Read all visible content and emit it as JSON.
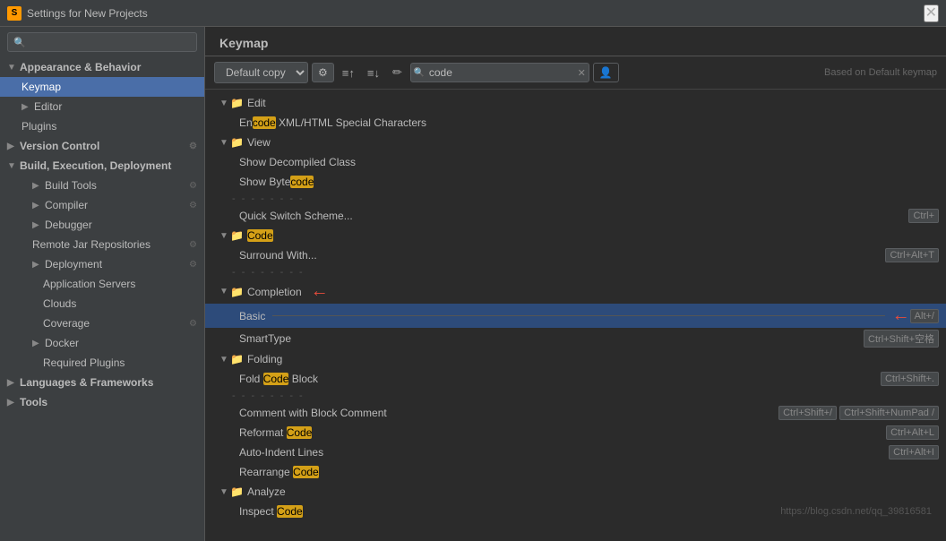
{
  "titlebar": {
    "icon": "S",
    "title": "Settings for New Projects",
    "close": "✕"
  },
  "sidebar": {
    "search_placeholder": "🔍",
    "items": [
      {
        "id": "appearance",
        "label": "Appearance & Behavior",
        "level": "category",
        "expand": "▼",
        "has_icon": false
      },
      {
        "id": "keymap",
        "label": "Keymap",
        "level": "sub1",
        "selected": true
      },
      {
        "id": "editor",
        "label": "Editor",
        "level": "category-sub",
        "expand": "▶"
      },
      {
        "id": "plugins",
        "label": "Plugins",
        "level": "sub1"
      },
      {
        "id": "version-control",
        "label": "Version Control",
        "level": "category",
        "expand": "▶",
        "settings": true
      },
      {
        "id": "build-exec",
        "label": "Build, Execution, Deployment",
        "level": "category",
        "expand": "▼"
      },
      {
        "id": "build-tools",
        "label": "Build Tools",
        "level": "sub1",
        "expand": "▶",
        "settings": true
      },
      {
        "id": "compiler",
        "label": "Compiler",
        "level": "sub1",
        "expand": "▶",
        "settings": true
      },
      {
        "id": "debugger",
        "label": "Debugger",
        "level": "sub1",
        "expand": "▶"
      },
      {
        "id": "remote-jar",
        "label": "Remote Jar Repositories",
        "level": "sub1",
        "settings": true
      },
      {
        "id": "deployment",
        "label": "Deployment",
        "level": "sub1",
        "expand": "▶",
        "settings": true
      },
      {
        "id": "app-servers",
        "label": "Application Servers",
        "level": "sub2"
      },
      {
        "id": "clouds",
        "label": "Clouds",
        "level": "sub2"
      },
      {
        "id": "coverage",
        "label": "Coverage",
        "level": "sub2",
        "settings": true
      },
      {
        "id": "docker",
        "label": "Docker",
        "level": "sub1",
        "expand": "▶"
      },
      {
        "id": "required-plugins",
        "label": "Required Plugins",
        "level": "sub2"
      },
      {
        "id": "languages",
        "label": "Languages & Frameworks",
        "level": "category",
        "expand": "▶"
      },
      {
        "id": "tools",
        "label": "Tools",
        "level": "category",
        "expand": "▶"
      }
    ]
  },
  "content": {
    "title": "Keymap",
    "keymap_select": "Default copy",
    "based_text": "Based on Default keymap",
    "search_value": "code",
    "toolbar_icons": [
      "≡↑",
      "≡↓",
      "✏"
    ],
    "tree": [
      {
        "type": "section",
        "label": "Edit",
        "expand": "▼",
        "indent": 0
      },
      {
        "type": "item",
        "pre": "En",
        "highlight": "code",
        "post": " XML/HTML Special Characters",
        "indent": 1
      },
      {
        "type": "section",
        "label": "View",
        "expand": "▼",
        "indent": 0
      },
      {
        "type": "item",
        "label": "Show Decompiled Class",
        "indent": 1
      },
      {
        "type": "item",
        "pre": "Show Byte",
        "highlight": "code",
        "post": "",
        "indent": 1
      },
      {
        "type": "divider",
        "indent": 1
      },
      {
        "type": "item",
        "label": "Quick Switch Scheme...",
        "indent": 1,
        "shortcut": "Ctrl+"
      },
      {
        "type": "section",
        "label": "Code",
        "expand": "▼",
        "indent": 0,
        "folder_highlight": true
      },
      {
        "type": "item",
        "label": "Surround With...",
        "indent": 1,
        "shortcut": "Ctrl+Alt+T"
      },
      {
        "type": "divider",
        "indent": 1
      },
      {
        "type": "section",
        "label": "Completion",
        "expand": "▼",
        "indent": 0
      },
      {
        "type": "item",
        "label": "Basic",
        "indent": 1,
        "shortcut": "Alt+/",
        "highlighted": true
      },
      {
        "type": "item",
        "label": "SmartType",
        "indent": 1,
        "shortcut": "Ctrl+Shift+空格"
      },
      {
        "type": "section",
        "label": "Folding",
        "expand": "▼",
        "indent": 0
      },
      {
        "type": "item",
        "pre": "Fold ",
        "highlight": "Code",
        "post": " Block",
        "indent": 1,
        "shortcut": "Ctrl+Shift+."
      },
      {
        "type": "divider",
        "indent": 1
      },
      {
        "type": "item",
        "label": "Comment with Block Comment",
        "indent": 1,
        "shortcut1": "Ctrl+Shift+/",
        "shortcut2": "Ctrl+Shift+NumPad /"
      },
      {
        "type": "item",
        "pre": "Reformat ",
        "highlight": "Code",
        "post": "",
        "indent": 1,
        "shortcut": "Ctrl+Alt+L"
      },
      {
        "type": "item",
        "label": "Auto-Indent Lines",
        "indent": 1,
        "shortcut": "Ctrl+Alt+I"
      },
      {
        "type": "item",
        "pre": "Rearrange ",
        "highlight": "Code",
        "post": "",
        "indent": 1
      },
      {
        "type": "section",
        "label": "Analyze",
        "expand": "▼",
        "indent": 0
      },
      {
        "type": "item",
        "pre": "Inspect ",
        "highlight": "Code",
        "post": "",
        "indent": 1
      }
    ],
    "url": "https://blog.csdn.net/qq_39816581"
  }
}
